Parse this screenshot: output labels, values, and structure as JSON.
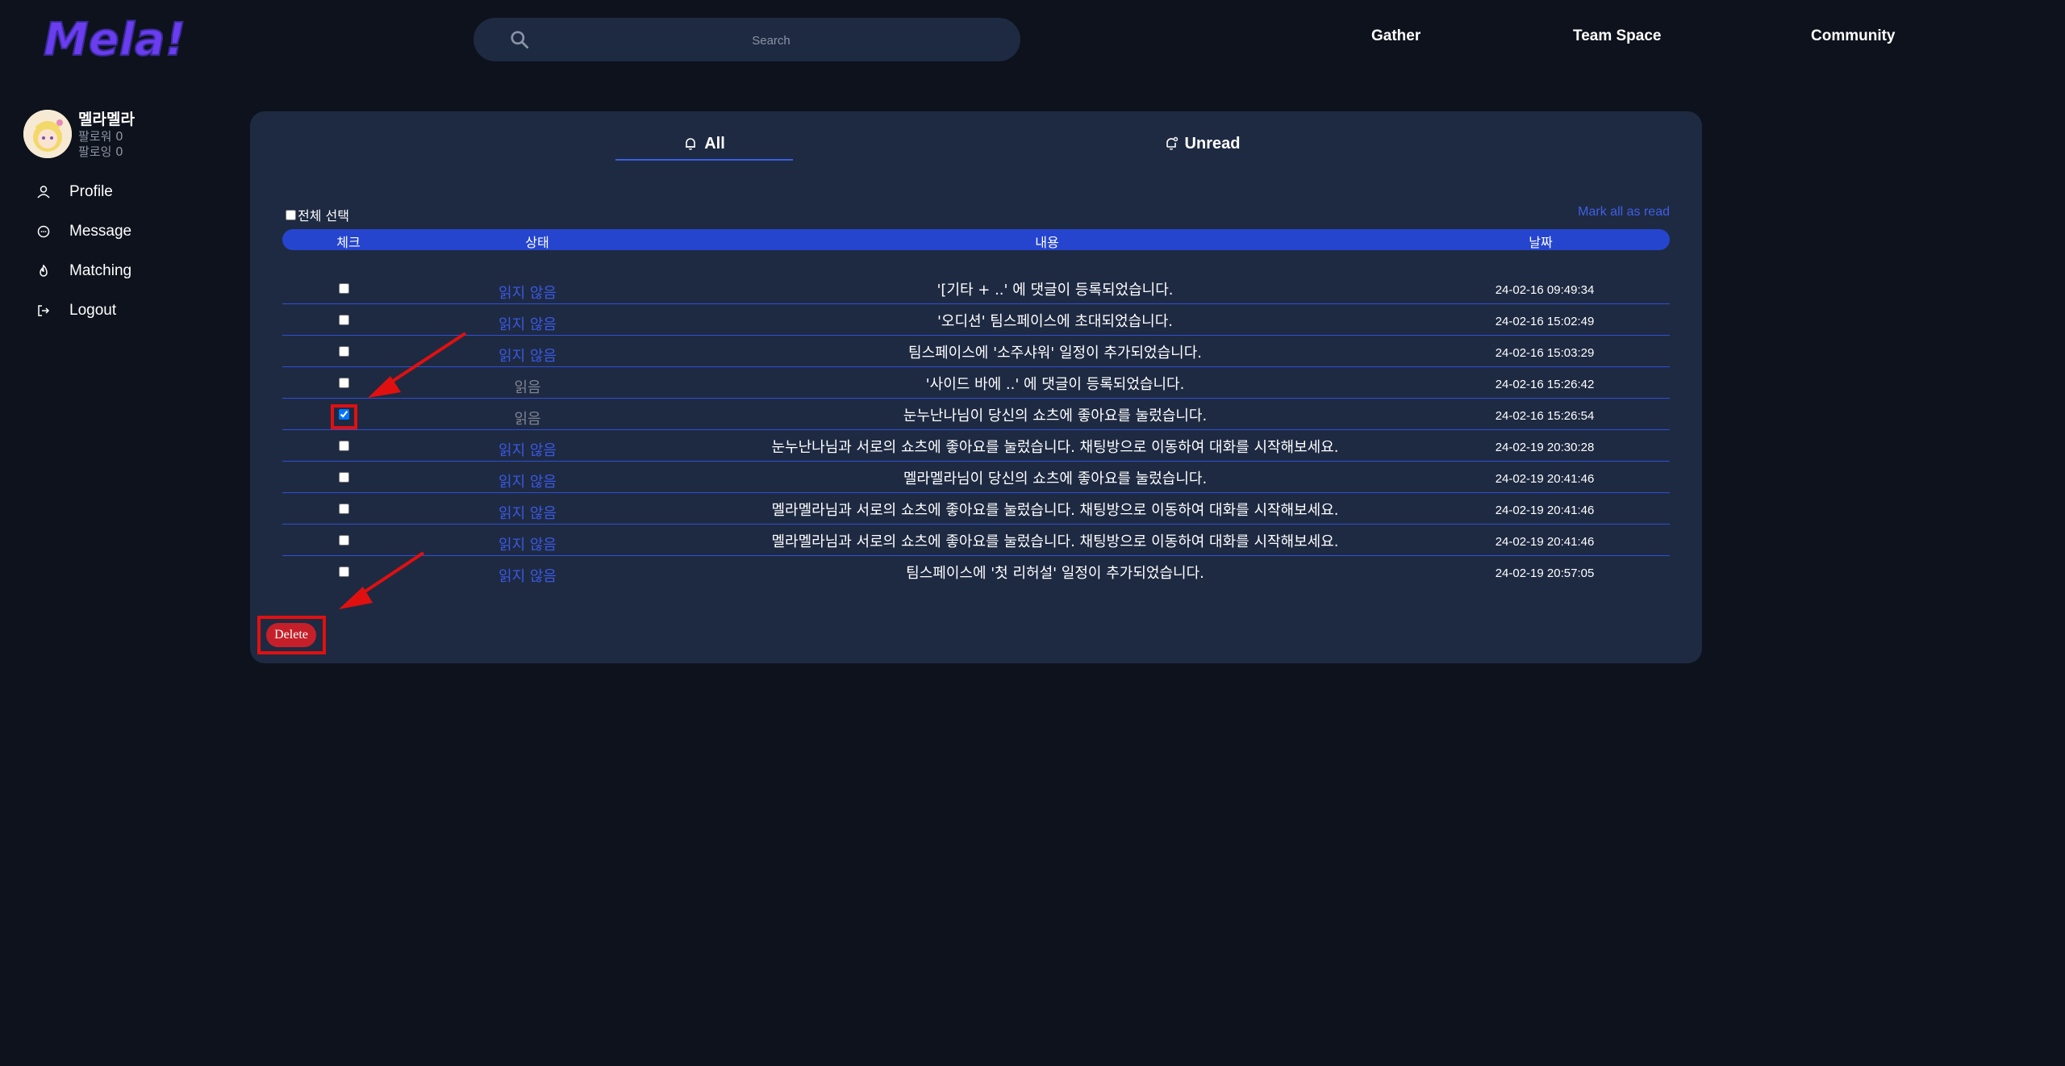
{
  "header": {
    "logo_text": "Mela!",
    "search": {
      "placeholder": "Search"
    },
    "nav": [
      "Gather",
      "Team Space",
      "Community"
    ]
  },
  "sidebar": {
    "user": {
      "name": "멜라멜라",
      "followers": "팔로워 0",
      "following": "팔로잉 0"
    },
    "items": [
      {
        "label": "Profile",
        "icon": "user-icon"
      },
      {
        "label": "Message",
        "icon": "message-icon"
      },
      {
        "label": "Matching",
        "icon": "fire-icon"
      },
      {
        "label": "Logout",
        "icon": "logout-icon"
      }
    ]
  },
  "notifications": {
    "tabs": [
      {
        "label": "All",
        "icon": "bell-icon",
        "active": true
      },
      {
        "label": "Unread",
        "icon": "bell-unread-icon",
        "active": false
      }
    ],
    "select_all_label": "전체 선택",
    "mark_all_label": "Mark all as read",
    "columns": [
      "체크",
      "상태",
      "내용",
      "날짜"
    ],
    "rows": [
      {
        "checked": false,
        "status": "읽지 않음",
        "read": false,
        "content": "'[기타 + ..' 에 댓글이 등록되었습니다.",
        "date": "24-02-16 09:49:34"
      },
      {
        "checked": false,
        "status": "읽지 않음",
        "read": false,
        "content": "'오디션' 팀스페이스에 초대되었습니다.",
        "date": "24-02-16 15:02:49"
      },
      {
        "checked": false,
        "status": "읽지 않음",
        "read": false,
        "content": "팀스페이스에 '소주샤워' 일정이 추가되었습니다.",
        "date": "24-02-16 15:03:29"
      },
      {
        "checked": false,
        "status": "읽음",
        "read": true,
        "content": "'사이드 바에 ..' 에 댓글이 등록되었습니다.",
        "date": "24-02-16 15:26:42"
      },
      {
        "checked": true,
        "status": "읽음",
        "read": true,
        "content": "눈누난나님이 당신의 쇼츠에 좋아요를 눌렀습니다.",
        "date": "24-02-16 15:26:54"
      },
      {
        "checked": false,
        "status": "읽지 않음",
        "read": false,
        "content": "눈누난나님과 서로의 쇼츠에 좋아요를 눌렀습니다. 채팅방으로 이동하여 대화를 시작해보세요.",
        "date": "24-02-19 20:30:28"
      },
      {
        "checked": false,
        "status": "읽지 않음",
        "read": false,
        "content": "멜라멜라님이 당신의 쇼츠에 좋아요를 눌렀습니다.",
        "date": "24-02-19 20:41:46"
      },
      {
        "checked": false,
        "status": "읽지 않음",
        "read": false,
        "content": "멜라멜라님과 서로의 쇼츠에 좋아요를 눌렀습니다. 채팅방으로 이동하여 대화를 시작해보세요.",
        "date": "24-02-19 20:41:46"
      },
      {
        "checked": false,
        "status": "읽지 않음",
        "read": false,
        "content": "멜라멜라님과 서로의 쇼츠에 좋아요를 눌렀습니다. 채팅방으로 이동하여 대화를 시작해보세요.",
        "date": "24-02-19 20:41:46"
      },
      {
        "checked": false,
        "status": "읽지 않음",
        "read": false,
        "content": "팀스페이스에 '첫 리허설' 일정이 추가되었습니다.",
        "date": "24-02-19 20:57:05"
      }
    ],
    "delete_label": "Delete"
  },
  "colors": {
    "background": "#0d121c",
    "panel": "#1e2a42",
    "accent": "#2545cf",
    "unread": "#3a58e4",
    "read": "#7d8392",
    "delete": "#c5202a",
    "annotation": "#e01010"
  }
}
